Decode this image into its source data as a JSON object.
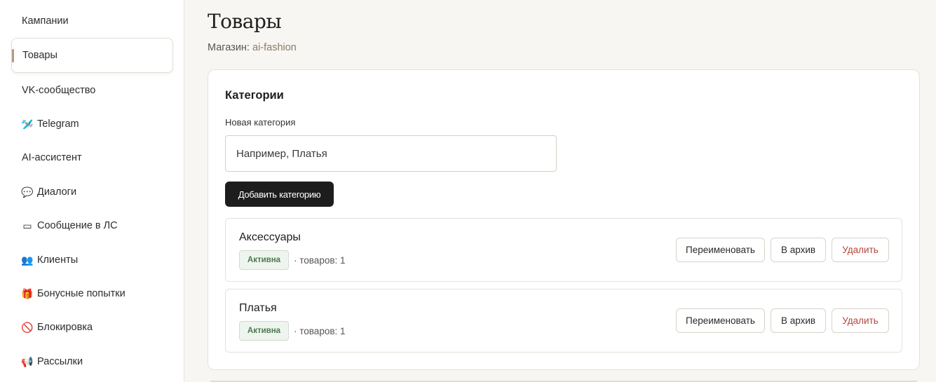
{
  "sidebar": {
    "items": [
      {
        "label": "Кампании",
        "icon": "",
        "icon_name": "",
        "active": false
      },
      {
        "label": "Товары",
        "icon": "",
        "icon_name": "",
        "active": true
      },
      {
        "label": "VK-сообщество",
        "icon": "",
        "icon_name": "",
        "active": false
      },
      {
        "label": "Telegram",
        "icon": "🛩️",
        "icon_name": "plane-icon",
        "active": false
      },
      {
        "label": "AI-ассистент",
        "icon": "",
        "icon_name": "",
        "active": false
      },
      {
        "label": "Диалоги",
        "icon": "💬",
        "icon_name": "speech-bubble-icon",
        "active": false
      },
      {
        "label": "Сообщение в ЛС",
        "icon": "▭",
        "icon_name": "envelope-icon",
        "active": false
      },
      {
        "label": "Клиенты",
        "icon": "👥",
        "icon_name": "people-icon",
        "active": false
      },
      {
        "label": "Бонусные попытки",
        "icon": "🎁",
        "icon_name": "gift-icon",
        "active": false
      },
      {
        "label": "Блокировка",
        "icon": "🚫",
        "icon_name": "block-icon",
        "active": false
      },
      {
        "label": "Рассылки",
        "icon": "📢",
        "icon_name": "megaphone-icon",
        "active": false
      }
    ]
  },
  "header": {
    "title": "Товары",
    "store_label": "Магазин:",
    "store_name": "ai-fashion"
  },
  "categories_card": {
    "title": "Категории",
    "new_label": "Новая категория",
    "input_value": "",
    "input_placeholder": "Например, Платья",
    "add_button": "Добавить категорию",
    "items": [
      {
        "name": "Аксессуары",
        "status": "Активна",
        "count_text": "· товаров: 1",
        "rename": "Переименовать",
        "archive": "В архив",
        "delete": "Удалить"
      },
      {
        "name": "Платья",
        "status": "Активна",
        "count_text": "· товаров: 1",
        "rename": "Переименовать",
        "archive": "В архив",
        "delete": "Удалить"
      }
    ]
  },
  "colors": {
    "accent": "#b49a82",
    "status_green": "#4b7a4f",
    "danger": "#b4453c",
    "primary_button": "#1d1d1d"
  }
}
